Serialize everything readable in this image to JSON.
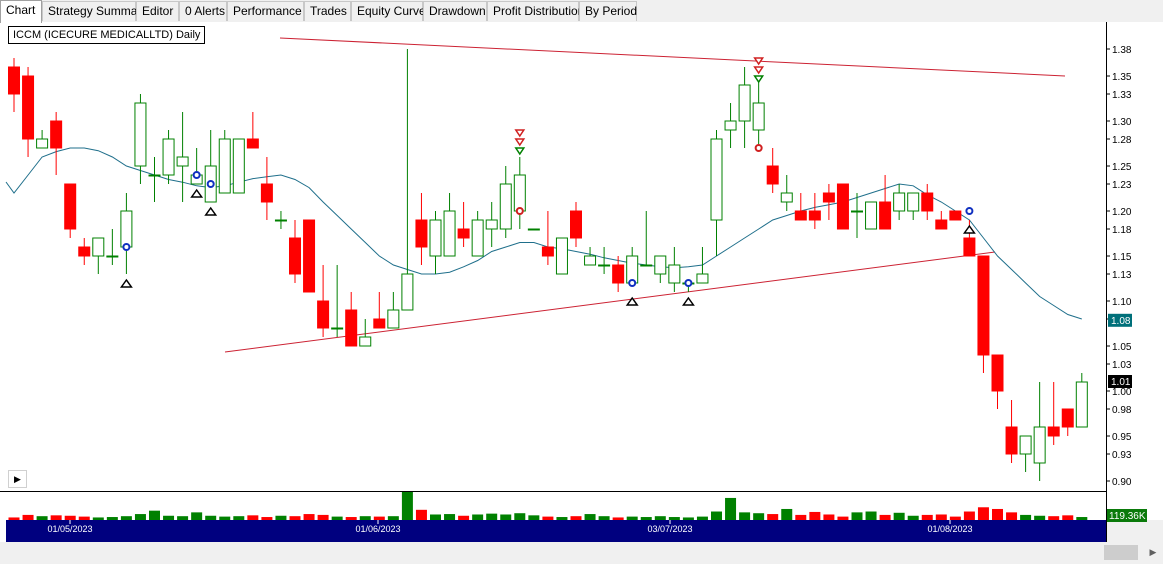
{
  "tabs": [
    {
      "label": "Chart",
      "active": true
    },
    {
      "label": "Strategy Summary"
    },
    {
      "label": "Editor"
    },
    {
      "label": "0 Alerts"
    },
    {
      "label": "Performance"
    },
    {
      "label": "Trades"
    },
    {
      "label": "Equity Curve"
    },
    {
      "label": "Drawdown"
    },
    {
      "label": "Profit Distribution"
    },
    {
      "label": "By Period"
    }
  ],
  "chart": {
    "title": "ICCM (ICECURE MEDICALLTD) Daily",
    "expand_icon": "triangle-right-icon",
    "last_ma_badge": "1.08",
    "last_close_badge": "1.01",
    "volume_badge": "119.36K",
    "colors": {
      "up": "#008000",
      "down": "#ff0000",
      "ma": "#1f6f8b",
      "trendline": "#cc2233",
      "date_bar": "#00007f",
      "badge_teal": "#00707a"
    }
  },
  "chart_data": {
    "type": "candlestick",
    "price_axis": {
      "min": 0.89,
      "max": 1.39,
      "ticks": [
        "0.90",
        "0.93",
        "0.95",
        "0.98",
        "1.00",
        "1.03",
        "1.05",
        "1.08",
        "1.10",
        "1.13",
        "1.15",
        "1.18",
        "1.20",
        "1.23",
        "1.25",
        "1.28",
        "1.30",
        "1.33",
        "1.35",
        "1.38"
      ]
    },
    "date_labels": [
      "01/05/2023",
      "01/06/2023",
      "03/07/2023",
      "01/08/2023"
    ],
    "candles": [
      {
        "o": 1.36,
        "h": 1.37,
        "l": 1.31,
        "c": 1.33
      },
      {
        "o": 1.35,
        "h": 1.36,
        "l": 1.26,
        "c": 1.28
      },
      {
        "o": 1.27,
        "h": 1.29,
        "l": 1.27,
        "c": 1.28
      },
      {
        "o": 1.3,
        "h": 1.31,
        "l": 1.24,
        "c": 1.27
      },
      {
        "o": 1.23,
        "h": 1.23,
        "l": 1.17,
        "c": 1.18
      },
      {
        "o": 1.16,
        "h": 1.17,
        "l": 1.14,
        "c": 1.15
      },
      {
        "o": 1.15,
        "h": 1.17,
        "l": 1.13,
        "c": 1.17
      },
      {
        "o": 1.15,
        "h": 1.18,
        "l": 1.14,
        "c": 1.15
      },
      {
        "o": 1.16,
        "h": 1.22,
        "l": 1.13,
        "c": 1.2
      },
      {
        "o": 1.25,
        "h": 1.33,
        "l": 1.23,
        "c": 1.32
      },
      {
        "o": 1.24,
        "h": 1.26,
        "l": 1.21,
        "c": 1.24
      },
      {
        "o": 1.24,
        "h": 1.29,
        "l": 1.23,
        "c": 1.28
      },
      {
        "o": 1.25,
        "h": 1.31,
        "l": 1.21,
        "c": 1.26
      },
      {
        "o": 1.23,
        "h": 1.27,
        "l": 1.23,
        "c": 1.24
      },
      {
        "o": 1.21,
        "h": 1.29,
        "l": 1.21,
        "c": 1.25
      },
      {
        "o": 1.22,
        "h": 1.29,
        "l": 1.22,
        "c": 1.28
      },
      {
        "o": 1.22,
        "h": 1.28,
        "l": 1.22,
        "c": 1.28
      },
      {
        "o": 1.28,
        "h": 1.31,
        "l": 1.27,
        "c": 1.27
      },
      {
        "o": 1.23,
        "h": 1.26,
        "l": 1.19,
        "c": 1.21
      },
      {
        "o": 1.19,
        "h": 1.2,
        "l": 1.18,
        "c": 1.19
      },
      {
        "o": 1.17,
        "h": 1.19,
        "l": 1.12,
        "c": 1.13
      },
      {
        "o": 1.19,
        "h": 1.19,
        "l": 1.11,
        "c": 1.11
      },
      {
        "o": 1.1,
        "h": 1.14,
        "l": 1.06,
        "c": 1.07
      },
      {
        "o": 1.07,
        "h": 1.14,
        "l": 1.06,
        "c": 1.07
      },
      {
        "o": 1.09,
        "h": 1.11,
        "l": 1.05,
        "c": 1.05
      },
      {
        "o": 1.05,
        "h": 1.08,
        "l": 1.05,
        "c": 1.06
      },
      {
        "o": 1.08,
        "h": 1.11,
        "l": 1.07,
        "c": 1.07
      },
      {
        "o": 1.07,
        "h": 1.11,
        "l": 1.07,
        "c": 1.09
      },
      {
        "o": 1.09,
        "h": 1.38,
        "l": 1.09,
        "c": 1.13
      },
      {
        "o": 1.19,
        "h": 1.22,
        "l": 1.14,
        "c": 1.16
      },
      {
        "o": 1.15,
        "h": 1.2,
        "l": 1.13,
        "c": 1.19
      },
      {
        "o": 1.15,
        "h": 1.22,
        "l": 1.15,
        "c": 1.2
      },
      {
        "o": 1.18,
        "h": 1.21,
        "l": 1.16,
        "c": 1.17
      },
      {
        "o": 1.15,
        "h": 1.2,
        "l": 1.15,
        "c": 1.19
      },
      {
        "o": 1.18,
        "h": 1.21,
        "l": 1.16,
        "c": 1.19
      },
      {
        "o": 1.18,
        "h": 1.25,
        "l": 1.17,
        "c": 1.23
      },
      {
        "o": 1.2,
        "h": 1.26,
        "l": 1.18,
        "c": 1.24
      },
      {
        "o": 1.18,
        "h": 1.18,
        "l": 1.18,
        "c": 1.18
      },
      {
        "o": 1.16,
        "h": 1.2,
        "l": 1.14,
        "c": 1.15
      },
      {
        "o": 1.13,
        "h": 1.17,
        "l": 1.13,
        "c": 1.17
      },
      {
        "o": 1.2,
        "h": 1.21,
        "l": 1.16,
        "c": 1.17
      },
      {
        "o": 1.14,
        "h": 1.16,
        "l": 1.14,
        "c": 1.15
      },
      {
        "o": 1.14,
        "h": 1.16,
        "l": 1.13,
        "c": 1.14
      },
      {
        "o": 1.14,
        "h": 1.15,
        "l": 1.11,
        "c": 1.12
      },
      {
        "o": 1.12,
        "h": 1.16,
        "l": 1.12,
        "c": 1.15
      },
      {
        "o": 1.14,
        "h": 1.2,
        "l": 1.14,
        "c": 1.14
      },
      {
        "o": 1.13,
        "h": 1.15,
        "l": 1.12,
        "c": 1.15
      },
      {
        "o": 1.12,
        "h": 1.16,
        "l": 1.11,
        "c": 1.14
      },
      {
        "o": 1.12,
        "h": 1.12,
        "l": 1.11,
        "c": 1.12
      },
      {
        "o": 1.12,
        "h": 1.16,
        "l": 1.12,
        "c": 1.13
      },
      {
        "o": 1.19,
        "h": 1.29,
        "l": 1.15,
        "c": 1.28
      },
      {
        "o": 1.29,
        "h": 1.32,
        "l": 1.27,
        "c": 1.3
      },
      {
        "o": 1.3,
        "h": 1.36,
        "l": 1.27,
        "c": 1.34
      },
      {
        "o": 1.29,
        "h": 1.35,
        "l": 1.27,
        "c": 1.32
      },
      {
        "o": 1.25,
        "h": 1.27,
        "l": 1.22,
        "c": 1.23
      },
      {
        "o": 1.21,
        "h": 1.24,
        "l": 1.2,
        "c": 1.22
      },
      {
        "o": 1.2,
        "h": 1.22,
        "l": 1.19,
        "c": 1.19
      },
      {
        "o": 1.2,
        "h": 1.22,
        "l": 1.18,
        "c": 1.19
      },
      {
        "o": 1.22,
        "h": 1.23,
        "l": 1.19,
        "c": 1.21
      },
      {
        "o": 1.23,
        "h": 1.23,
        "l": 1.18,
        "c": 1.18
      },
      {
        "o": 1.2,
        "h": 1.22,
        "l": 1.17,
        "c": 1.2
      },
      {
        "o": 1.18,
        "h": 1.21,
        "l": 1.18,
        "c": 1.21
      },
      {
        "o": 1.21,
        "h": 1.24,
        "l": 1.18,
        "c": 1.18
      },
      {
        "o": 1.2,
        "h": 1.23,
        "l": 1.19,
        "c": 1.22
      },
      {
        "o": 1.2,
        "h": 1.22,
        "l": 1.19,
        "c": 1.22
      },
      {
        "o": 1.22,
        "h": 1.23,
        "l": 1.19,
        "c": 1.2
      },
      {
        "o": 1.19,
        "h": 1.2,
        "l": 1.18,
        "c": 1.18
      },
      {
        "o": 1.2,
        "h": 1.2,
        "l": 1.19,
        "c": 1.19
      },
      {
        "o": 1.17,
        "h": 1.19,
        "l": 1.15,
        "c": 1.15
      },
      {
        "o": 1.15,
        "h": 1.15,
        "l": 1.02,
        "c": 1.04
      },
      {
        "o": 1.04,
        "h": 1.04,
        "l": 0.98,
        "c": 1.0
      },
      {
        "o": 0.96,
        "h": 0.99,
        "l": 0.92,
        "c": 0.93
      },
      {
        "o": 0.93,
        "h": 0.95,
        "l": 0.91,
        "c": 0.95
      },
      {
        "o": 0.92,
        "h": 1.01,
        "l": 0.9,
        "c": 0.96
      },
      {
        "o": 0.96,
        "h": 1.01,
        "l": 0.94,
        "c": 0.95
      },
      {
        "o": 0.98,
        "h": 0.98,
        "l": 0.95,
        "c": 0.96
      },
      {
        "o": 0.96,
        "h": 1.02,
        "l": 0.96,
        "c": 1.01
      }
    ],
    "moving_average": [
      1.22,
      1.24,
      1.26,
      1.266,
      1.27,
      1.27,
      1.267,
      1.26,
      1.25,
      1.245,
      1.24,
      1.235,
      1.232,
      1.228,
      1.226,
      1.228,
      1.232,
      1.236,
      1.238,
      1.24,
      1.235,
      1.226,
      1.21,
      1.195,
      1.18,
      1.165,
      1.15,
      1.14,
      1.135,
      1.13,
      1.13,
      1.132,
      1.138,
      1.145,
      1.155,
      1.16,
      1.165,
      1.165,
      1.16,
      1.158,
      1.155,
      1.152,
      1.148,
      1.145,
      1.142,
      1.14,
      1.138,
      1.137,
      1.138,
      1.14,
      1.15,
      1.16,
      1.17,
      1.18,
      1.19,
      1.195,
      1.2,
      1.204,
      1.207,
      1.21,
      1.215,
      1.22,
      1.225,
      1.23,
      1.228,
      1.218,
      1.21,
      1.2,
      1.19,
      1.17,
      1.15,
      1.135,
      1.12,
      1.105,
      1.095,
      1.085,
      1.08
    ],
    "volume": [
      30,
      60,
      45,
      55,
      50,
      40,
      30,
      35,
      45,
      70,
      110,
      50,
      45,
      90,
      50,
      40,
      45,
      55,
      35,
      50,
      45,
      70,
      60,
      40,
      35,
      45,
      40,
      45,
      330,
      120,
      65,
      70,
      50,
      65,
      75,
      65,
      80,
      55,
      40,
      35,
      45,
      70,
      45,
      30,
      40,
      35,
      45,
      35,
      30,
      40,
      100,
      260,
      90,
      80,
      70,
      130,
      60,
      95,
      65,
      40,
      90,
      100,
      60,
      85,
      50,
      60,
      65,
      40,
      100,
      150,
      130,
      90,
      60,
      50,
      45,
      55,
      35
    ],
    "trendlines": [
      {
        "from": [
          0,
          1.35
        ],
        "to": [
          76,
          1.34
        ]
      },
      {
        "from": [
          8,
          1.07
        ],
        "to": [
          70,
          1.14
        ]
      }
    ],
    "signals": [
      {
        "i": 8,
        "type": "buy-dot",
        "y": 1.16
      },
      {
        "i": 8,
        "type": "up-arrow",
        "y": 1.12
      },
      {
        "i": 13,
        "type": "buy-dot",
        "y": 1.24
      },
      {
        "i": 13,
        "type": "up-arrow",
        "y": 1.22
      },
      {
        "i": 14,
        "type": "buy-dot",
        "y": 1.23
      },
      {
        "i": 14,
        "type": "up-arrow",
        "y": 1.2
      },
      {
        "i": 36,
        "type": "sell-dot",
        "y": 1.2
      },
      {
        "i": 36,
        "type": "down-arrows",
        "y": 1.29
      },
      {
        "i": 44,
        "type": "buy-dot",
        "y": 1.12
      },
      {
        "i": 44,
        "type": "up-arrow",
        "y": 1.1
      },
      {
        "i": 48,
        "type": "buy-dot",
        "y": 1.12
      },
      {
        "i": 48,
        "type": "up-arrow",
        "y": 1.1
      },
      {
        "i": 53,
        "type": "sell-dot",
        "y": 1.27
      },
      {
        "i": 53,
        "type": "down-arrows",
        "y": 1.37
      },
      {
        "i": 68,
        "type": "buy-dot",
        "y": 1.2
      },
      {
        "i": 68,
        "type": "up-arrow",
        "y": 1.18
      }
    ]
  }
}
